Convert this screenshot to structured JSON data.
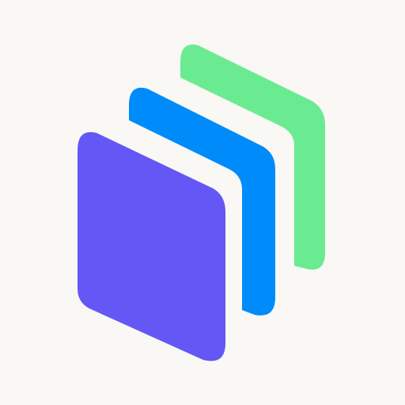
{
  "app_icon": {
    "icon_name": "stacked-layers-icon",
    "background_color": "#F9F8F5",
    "layers": [
      {
        "name": "back-layer",
        "color": "#6BEB91"
      },
      {
        "name": "middle-layer",
        "color": "#008BFA"
      },
      {
        "name": "front-layer",
        "color": "#6457F5"
      }
    ]
  }
}
